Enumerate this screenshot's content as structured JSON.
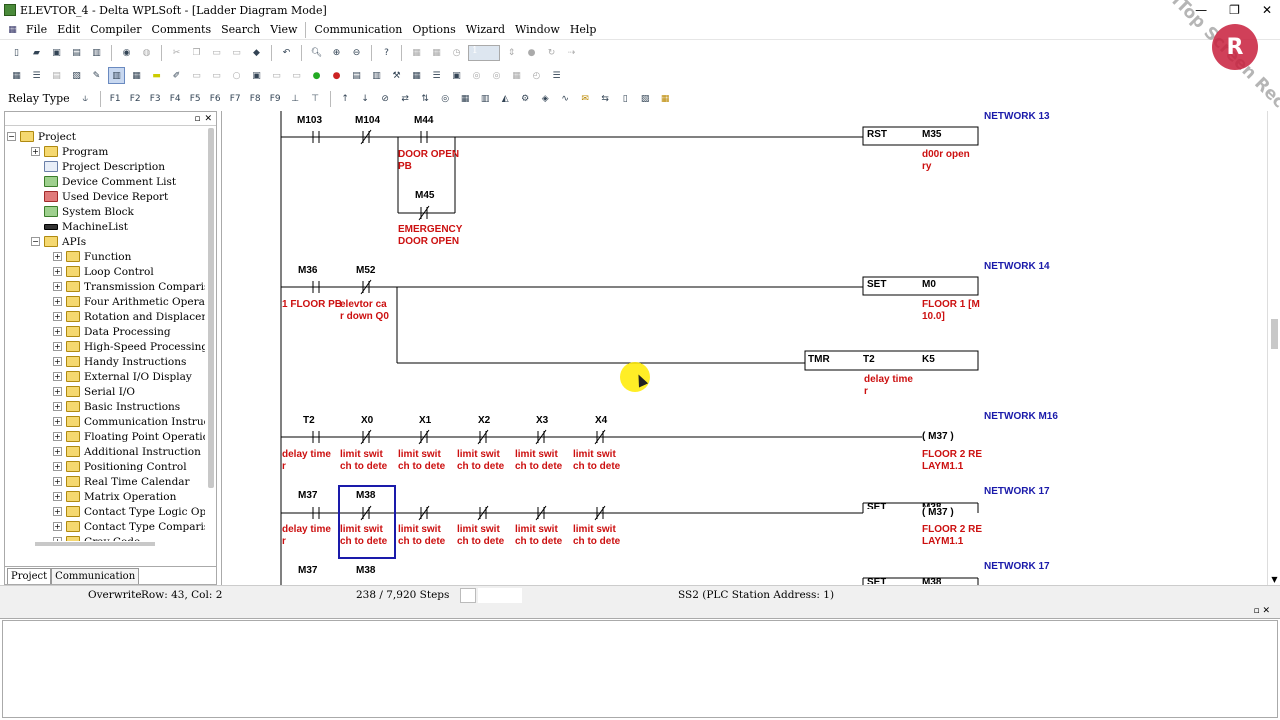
{
  "window": {
    "title": "ELEVTOR_4 - Delta WPLSoft - [Ladder Diagram Mode]",
    "buttons": [
      "—",
      "❐",
      "✕"
    ]
  },
  "menu": [
    {
      "label": "File",
      "key": "F"
    },
    {
      "label": "Edit",
      "key": "E"
    },
    {
      "label": "Compiler",
      "key": ""
    },
    {
      "label": "Comments",
      "key": ""
    },
    {
      "label": "Search",
      "key": ""
    },
    {
      "label": "View",
      "key": "V"
    },
    {
      "label": "Communication",
      "key": ""
    },
    {
      "label": "Options",
      "key": ""
    },
    {
      "label": "Wizard",
      "key": ""
    },
    {
      "label": "Window",
      "key": ""
    },
    {
      "label": "Help",
      "key": ""
    }
  ],
  "toolbar": {
    "relay_type_label": "Relay Type",
    "step_value": "1"
  },
  "tree": {
    "root": "Project",
    "items": [
      {
        "label": "Program",
        "level": 1,
        "icon": "folder",
        "expander": "+"
      },
      {
        "label": "Project Description",
        "level": 1,
        "icon": "doc",
        "expander": ""
      },
      {
        "label": "Device Comment List",
        "level": 1,
        "icon": "green",
        "expander": ""
      },
      {
        "label": "Used Device Report",
        "level": 1,
        "icon": "red",
        "expander": ""
      },
      {
        "label": "System Block",
        "level": 1,
        "icon": "green",
        "expander": ""
      },
      {
        "label": "MachineList",
        "level": 1,
        "icon": "dark",
        "expander": ""
      },
      {
        "label": "APIs",
        "level": 1,
        "icon": "folder",
        "expander": "−"
      },
      {
        "label": "Function",
        "level": 2,
        "icon": "folder",
        "expander": "+"
      },
      {
        "label": "Loop Control",
        "level": 2,
        "icon": "folder",
        "expander": "+"
      },
      {
        "label": "Transmission Comparison",
        "level": 2,
        "icon": "folder",
        "expander": "+"
      },
      {
        "label": "Four Arithmetic Operations",
        "level": 2,
        "icon": "folder",
        "expander": "+"
      },
      {
        "label": "Rotation and Displacement",
        "level": 2,
        "icon": "folder",
        "expander": "+"
      },
      {
        "label": "Data Processing",
        "level": 2,
        "icon": "folder",
        "expander": "+"
      },
      {
        "label": "High-Speed Processing",
        "level": 2,
        "icon": "folder",
        "expander": "+"
      },
      {
        "label": "Handy Instructions",
        "level": 2,
        "icon": "folder",
        "expander": "+"
      },
      {
        "label": "External I/O Display",
        "level": 2,
        "icon": "folder",
        "expander": "+"
      },
      {
        "label": "Serial I/O",
        "level": 2,
        "icon": "folder",
        "expander": "+"
      },
      {
        "label": "Basic Instructions",
        "level": 2,
        "icon": "folder",
        "expander": "+"
      },
      {
        "label": "Communication Instructions",
        "level": 2,
        "icon": "folder",
        "expander": "+"
      },
      {
        "label": "Floating Point Operation",
        "level": 2,
        "icon": "folder",
        "expander": "+"
      },
      {
        "label": "Additional Instruction",
        "level": 2,
        "icon": "folder",
        "expander": "+"
      },
      {
        "label": "Positioning Control",
        "level": 2,
        "icon": "folder",
        "expander": "+"
      },
      {
        "label": "Real Time Calendar",
        "level": 2,
        "icon": "folder",
        "expander": "+"
      },
      {
        "label": "Matrix Operation",
        "level": 2,
        "icon": "folder",
        "expander": "+"
      },
      {
        "label": "Contact Type Logic Operati",
        "level": 2,
        "icon": "folder",
        "expander": "+"
      },
      {
        "label": "Contact Type Comparison",
        "level": 2,
        "icon": "folder",
        "expander": "+"
      },
      {
        "label": "Gray Code",
        "level": 2,
        "icon": "folder",
        "expander": "+"
      }
    ]
  },
  "tabs": [
    "Project",
    "Communication"
  ],
  "ladder": {
    "networks": [
      "NETWORK  13",
      "NETWORK 14",
      "NETWORK M16",
      "NETWORK 17",
      "NETWORK 17"
    ],
    "labels": {
      "m103": "M103",
      "m104": "M104",
      "m44": "M44",
      "m45": "M45",
      "rst": "RST",
      "m35": "M35",
      "c_door1": "DOOR OPEN",
      "c_door2": "PB",
      "c_emg1": "EMERGENCY",
      "c_emg2": "DOOR OPEN",
      "c_m35a": "d00r open",
      "c_m35b": "ry",
      "m36": "M36",
      "m52": "M52",
      "set1": "SET",
      "m0": "M0",
      "c_1f": "1 FLOOR PB",
      "c_ev1": "elevtor ca",
      "c_ev2": "r down  Q0",
      "c_f1a": "FLOOR 1 [M",
      "c_f1b": "10.0]",
      "tmr": "TMR",
      "t2": "T2",
      "k5": "K5",
      "c_dt1": "delay time",
      "c_dt2": "r",
      "t2b": "T2",
      "x0": "X0",
      "x1": "X1",
      "x2": "X2",
      "x3": "X3",
      "x4": "X4",
      "coil_m37": "M37",
      "c_ls1": "limit swit",
      "c_ls2": "ch to dete",
      "c_f2a": "FLOOR 2 RE",
      "c_f2b": "LAYM1.1",
      "m37": "M37",
      "m38": "M38",
      "set_trunc": "SET",
      "m38_trunc": "M38",
      "m37c": "M37",
      "m38c": "M38",
      "set_trunc2": "SET",
      "m38_trunc2": "M38",
      "coil_m37_paren": "(  M37   )"
    }
  },
  "status": {
    "mode": "Overwrite",
    "position": "Row: 43, Col: 2",
    "steps": "238 / 7,920 Steps",
    "station": "SS2 (PLC Station Address: 1)"
  },
  "watermark": {
    "text": "iTop Screen Recorder"
  },
  "colors": {
    "comment": "#cc1010",
    "network": "#1a1aaa",
    "selection": "#1a1aaa",
    "cursor_highlight": "#ffe600"
  }
}
